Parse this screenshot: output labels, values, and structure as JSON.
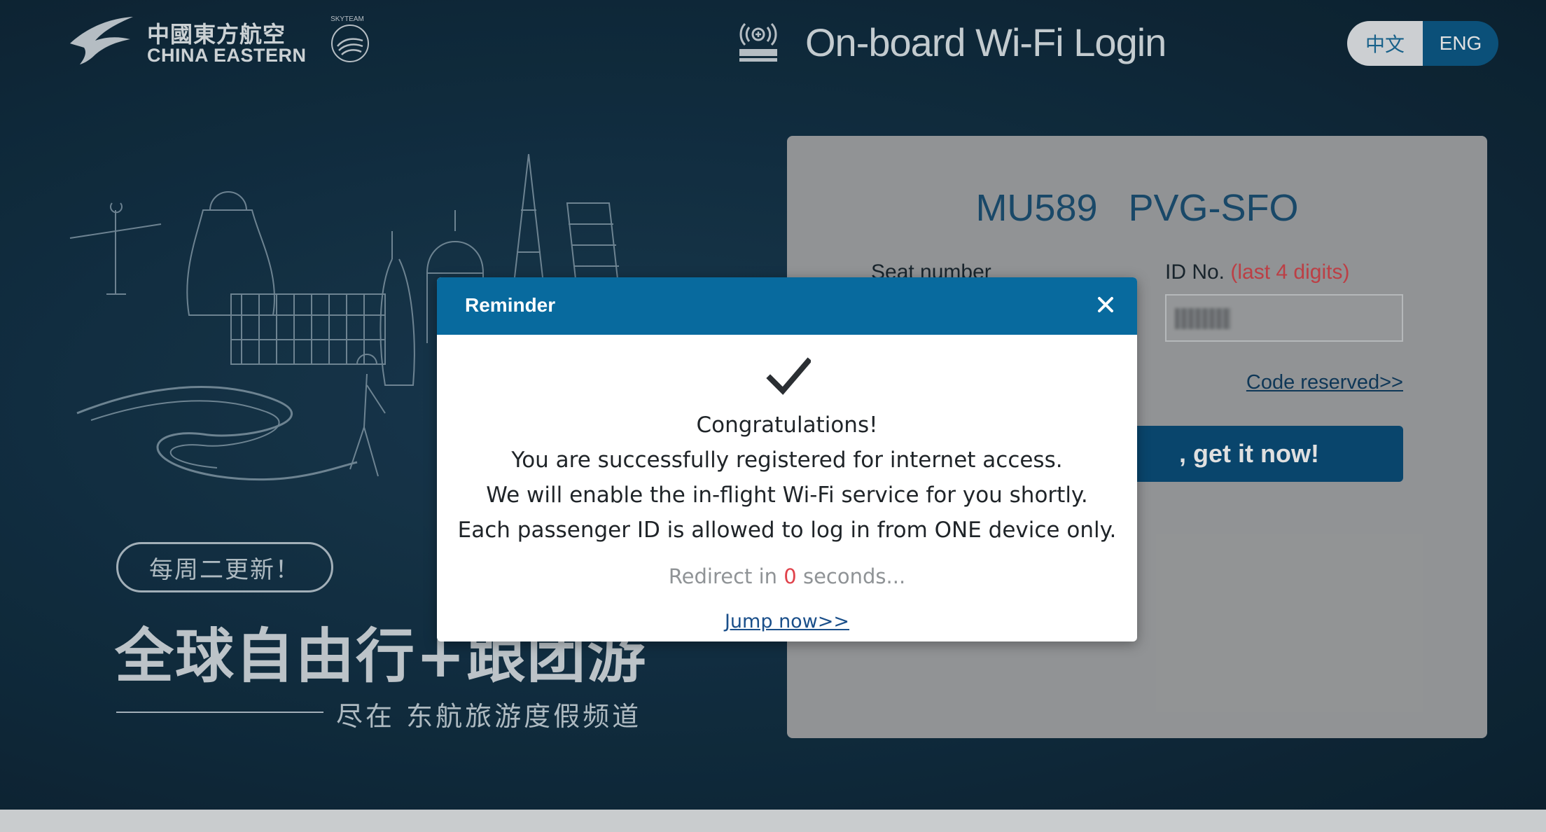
{
  "header": {
    "logo_cn": "中國東方航空",
    "logo_en": "CHINA EASTERN",
    "skyteam_text": "SKYTEAM",
    "wifi_badge_icon": "wifi-onboard-icon",
    "title": "On-board Wi-Fi Login",
    "language_options": [
      "中文",
      "ENG"
    ],
    "selected_language": "ENG"
  },
  "promo": {
    "badge": "每周二更新！",
    "title": "全球自由行+跟团游",
    "subtitle": "尽在 东航旅游度假频道"
  },
  "login": {
    "flight_number": "MU589",
    "route": "PVG-SFO",
    "seat_label": "Seat number",
    "id_label": "ID No.",
    "id_hint": "(last 4 digits)",
    "code_reserved": "Code reserved>>",
    "submit_label": ", get it now!"
  },
  "modal": {
    "title": "Reminder",
    "close_icon": "close-icon",
    "check_icon": "checkmark-icon",
    "line1": "Congratulations!",
    "line2": "You are successfully registered for internet access.",
    "line3": "We will enable the in-flight Wi-Fi service for you shortly.",
    "line4": "Each passenger ID is allowed to log in from ONE device only.",
    "redirect_prefix": "Redirect in",
    "redirect_count": "0",
    "redirect_suffix": "seconds...",
    "jump_link": "Jump now>>"
  },
  "colors": {
    "header_bg": "#0f2a3c",
    "modal_header": "#086a9e",
    "accent_red": "#e0424b",
    "button_blue": "#0b4f7b"
  }
}
